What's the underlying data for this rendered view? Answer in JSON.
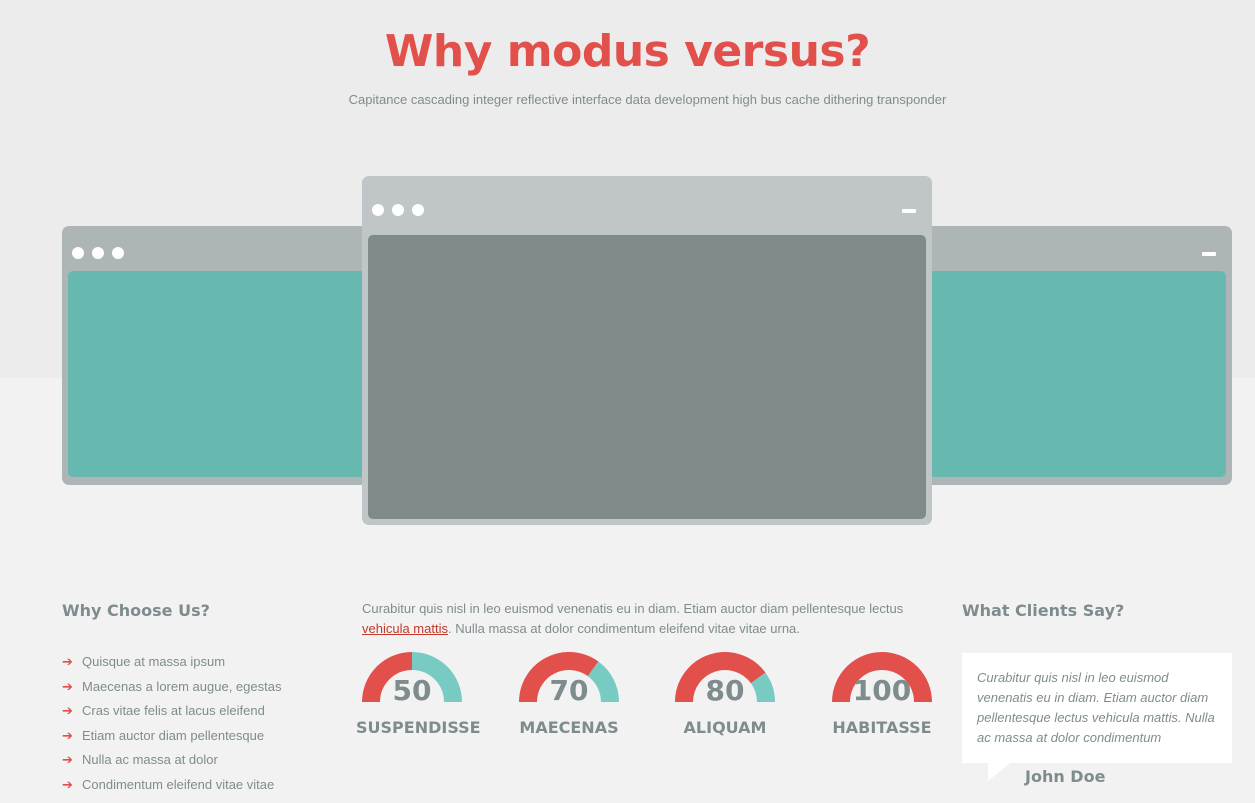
{
  "hero": {
    "title": "Why modus versus?",
    "subtitle": "Capitance cascading integer reflective interface data development high bus cache dithering transponder"
  },
  "colors": {
    "accent": "#e2504c",
    "teal": "#78cbc3",
    "text": "#7f8c8d",
    "screen_teal": "#67b9af",
    "screen_gray": "#7f8b8a"
  },
  "why_choose": {
    "heading": "Why Choose Us?",
    "items": [
      "Quisque at massa ipsum",
      "Maecenas a lorem augue, egestas",
      "Cras vitae felis at lacus eleifend",
      "Etiam auctor diam pellentesque",
      "Nulla ac massa at dolor",
      "Condimentum eleifend vitae vitae"
    ],
    "arrow_icon": "arrow-right-icon"
  },
  "intro": {
    "before_link": "Curabitur quis nisl in leo euismod venenatis eu in diam. Etiam auctor diam pellentesque lectus ",
    "link_text": "vehicula mattis",
    "after_link": ". Nulla massa at dolor condimentum eleifend vitae vitae urna."
  },
  "gauges": [
    {
      "value": "50",
      "percent": 50,
      "label": "SUSPENDISSE"
    },
    {
      "value": "70",
      "percent": 70,
      "label": "MAECENAS"
    },
    {
      "value": "80",
      "percent": 80,
      "label": "ALIQUAM"
    },
    {
      "value": "100",
      "percent": 100,
      "label": "HABITASSE"
    }
  ],
  "clients": {
    "heading": "What Clients Say?",
    "quote": "Curabitur quis nisl in leo euismod venenatis eu in diam. Etiam auctor diam pellentesque lectus vehicula mattis. Nulla ac massa at dolor condimentum",
    "name": "John Doe"
  }
}
